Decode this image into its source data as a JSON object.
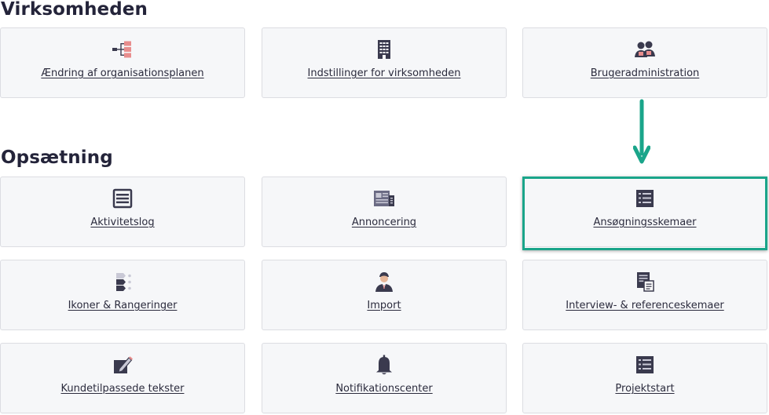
{
  "sections": {
    "virksomheden": {
      "title": "Virksomheden",
      "items": [
        {
          "label": "Ændring af organisationsplanen",
          "icon": "org-chart-icon"
        },
        {
          "label": "Indstillinger for virksomheden",
          "icon": "building-icon"
        },
        {
          "label": "Brugeradministration",
          "icon": "users-icon"
        }
      ]
    },
    "opsaetning": {
      "title": "Opsætning",
      "items": [
        {
          "label": "Aktivitetslog",
          "icon": "list-icon"
        },
        {
          "label": "Annoncering",
          "icon": "newspaper-icon"
        },
        {
          "label": "Ansøgningsskemaer",
          "icon": "form-icon"
        },
        {
          "label": "Ikoner & Rangeringer",
          "icon": "ranking-icon"
        },
        {
          "label": "Import",
          "icon": "person-icon"
        },
        {
          "label": "Interview- & referenceskemaer",
          "icon": "document-icon"
        },
        {
          "label": "Kundetilpassede tekster",
          "icon": "edit-icon"
        },
        {
          "label": "Notifikationscenter",
          "icon": "bell-icon"
        },
        {
          "label": "Projektstart",
          "icon": "form-icon"
        }
      ]
    }
  },
  "colors": {
    "accent": "#1aa58a",
    "icon_dark": "#3a3a4e",
    "icon_accent": "#e88d8d",
    "card_bg": "#f6f7f9",
    "card_border": "#dcdde2"
  }
}
